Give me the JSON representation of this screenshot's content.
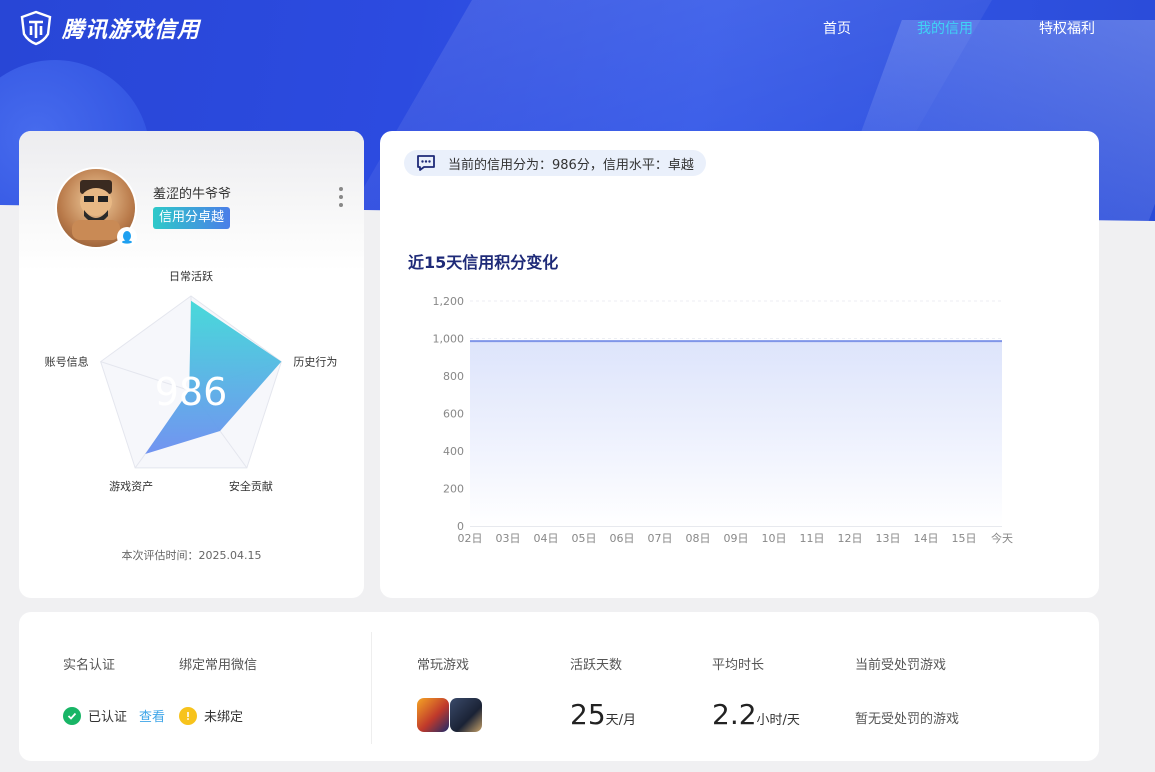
{
  "header": {
    "brand": "腾讯游戏信用",
    "nav": [
      {
        "label": "首页",
        "active": false
      },
      {
        "label": "我的信用",
        "active": true
      },
      {
        "label": "特权福利",
        "active": false
      }
    ]
  },
  "profile": {
    "username": "羞涩的牛爷爷",
    "badge": "信用分卓越",
    "score": "986",
    "eval_time": "本次评估时间：2025.04.15",
    "radar_axes": [
      "日常活跃",
      "历史行为",
      "安全贡献",
      "游戏资产",
      "账号信息"
    ],
    "radar_values": [
      0.95,
      1.0,
      0.52,
      0.82,
      0.02
    ]
  },
  "credit": {
    "notice": "当前的信用分为：986分，信用水平：卓越",
    "chart_title": "近15天信用积分变化"
  },
  "chart_data": {
    "type": "area",
    "title": "近15天信用积分变化",
    "categories": [
      "02日",
      "03日",
      "04日",
      "05日",
      "06日",
      "07日",
      "08日",
      "09日",
      "10日",
      "11日",
      "12日",
      "13日",
      "14日",
      "15日",
      "今天"
    ],
    "values": [
      986,
      986,
      986,
      986,
      986,
      986,
      986,
      986,
      986,
      986,
      986,
      986,
      986,
      986,
      986
    ],
    "y_ticks": [
      "0",
      "200",
      "400",
      "600",
      "800",
      "1,000",
      "1,200"
    ],
    "ylim": [
      0,
      1200
    ],
    "grid": "horizontal dashed",
    "line_color": "#7f95e8"
  },
  "stats": {
    "realname_label": "实名认证",
    "realname_value": "已认证",
    "realname_link": "查看",
    "wechat_label": "绑定常用微信",
    "wechat_value": "未绑定",
    "games_label": "常玩游戏",
    "active_days_label": "活跃天数",
    "active_days": "25",
    "active_days_unit": "天/月",
    "avg_time_label": "平均时长",
    "avg_time": "2.2",
    "avg_time_unit": "小时/天",
    "penalty_label": "当前受处罚游戏",
    "penalty_value": "暂无受处罚的游戏"
  },
  "colors": {
    "hero_blue": "#2c4be0",
    "active_nav": "#3fd3f5",
    "radar_fill_top": "#3fd8d8",
    "radar_fill_bottom": "#6b8ef0",
    "title_navy": "#1e2a78",
    "check_green": "#18b566",
    "warn_yellow": "#f7c31c",
    "link_blue": "#3ea5e8"
  }
}
